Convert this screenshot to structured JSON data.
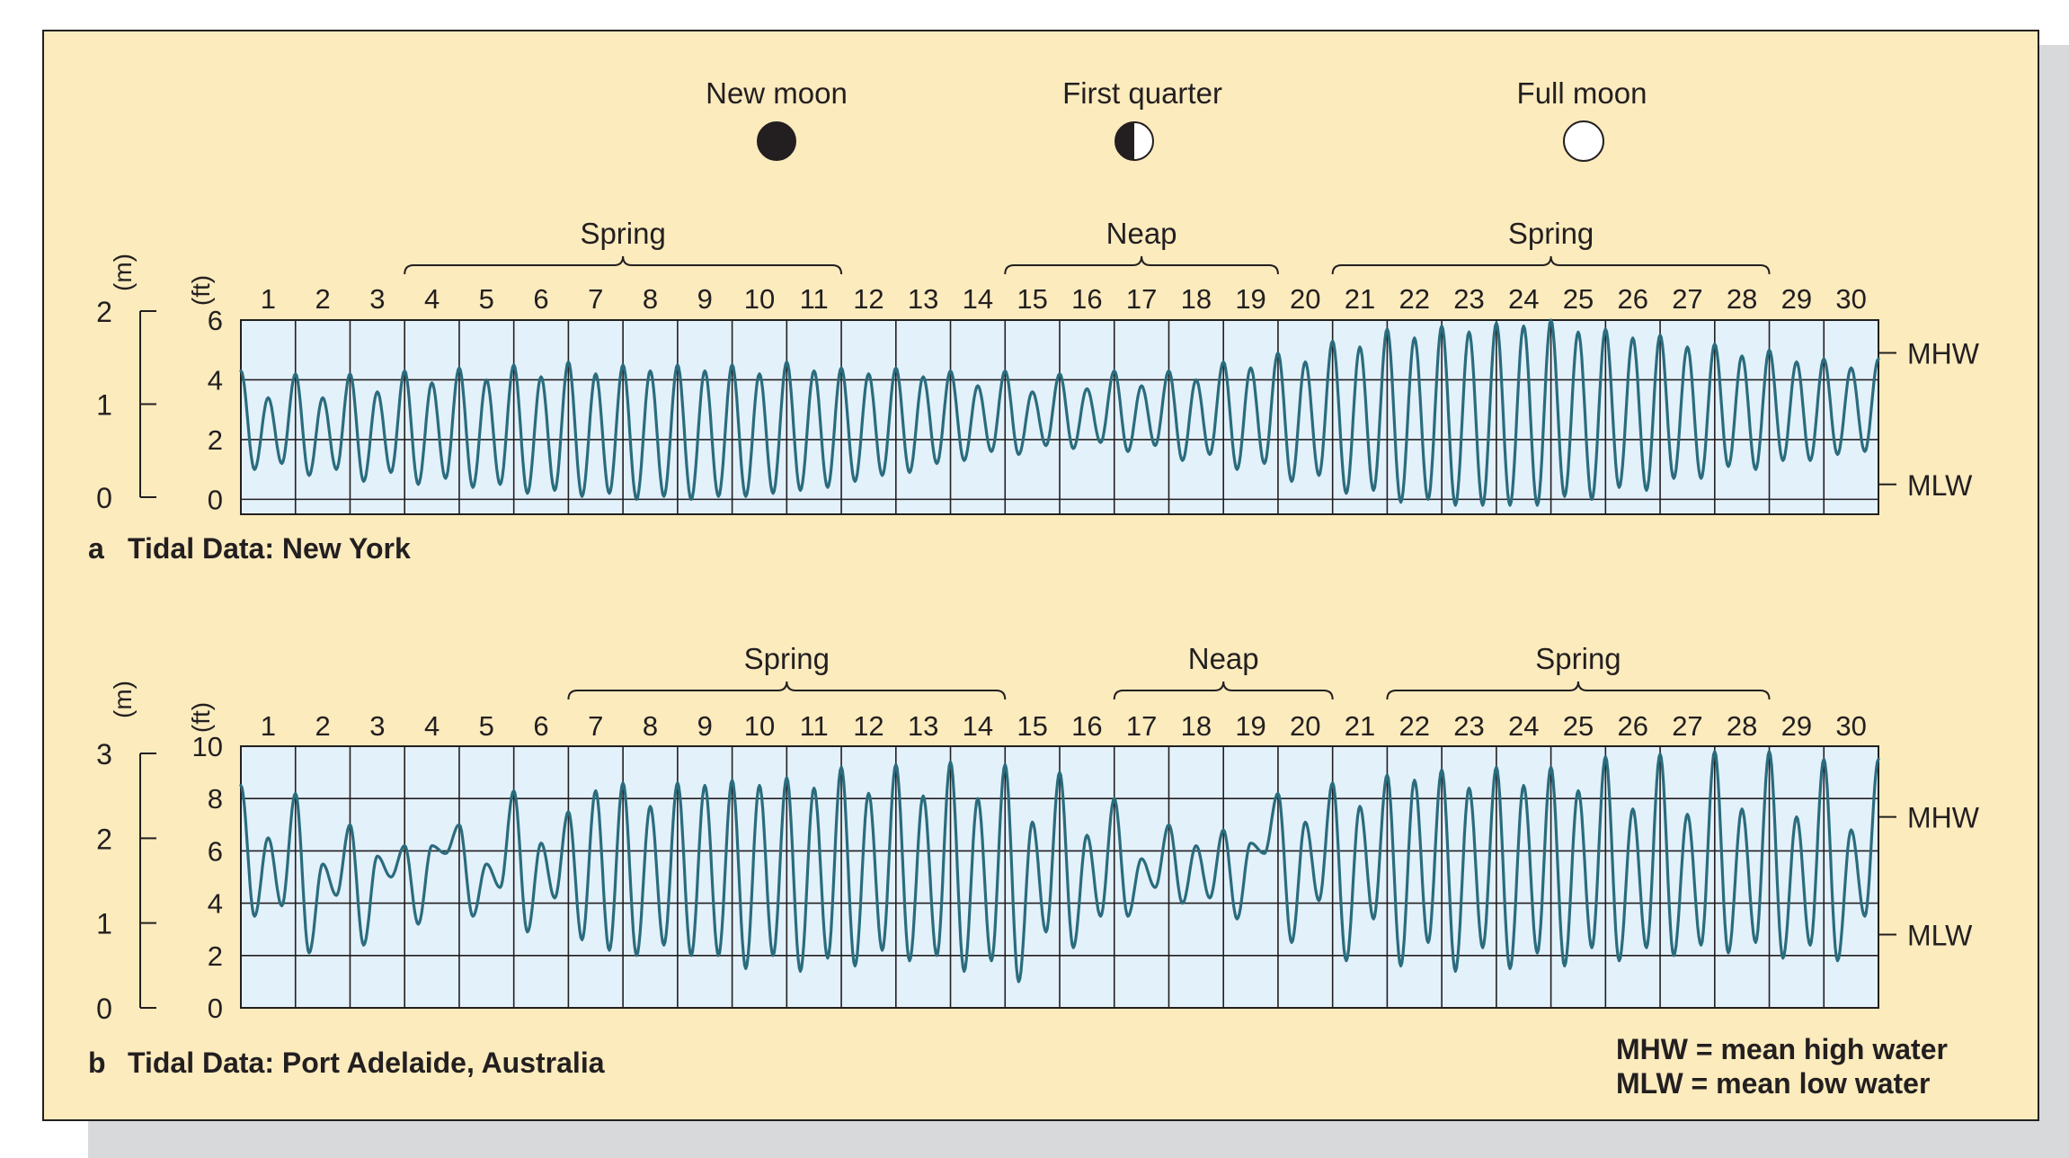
{
  "moon_phases": [
    {
      "label": "New moon",
      "icon": "new-moon-icon",
      "day": 10.3
    },
    {
      "label": "First quarter",
      "icon": "first-quarter-moon-icon",
      "day": 16.9
    },
    {
      "label": "Full moon",
      "icon": "full-moon-icon",
      "day": 24.9
    }
  ],
  "legend": {
    "mhw": "MHW = mean high water",
    "mlw": "MLW = mean low water"
  },
  "colors": {
    "frame_background": "#fbebbd",
    "plot_background": "#e3f1fb",
    "curve": "#2a6c7d",
    "grid": "#231f20"
  },
  "chart_data": [
    {
      "type": "line",
      "panel_letter": "a",
      "title": "Tidal Data: New York",
      "xlabel": "",
      "x_ticks": [
        1,
        2,
        3,
        4,
        5,
        6,
        7,
        8,
        9,
        10,
        11,
        12,
        13,
        14,
        15,
        16,
        17,
        18,
        19,
        20,
        21,
        22,
        23,
        24,
        25,
        26,
        27,
        28,
        29,
        30
      ],
      "x_range": [
        0.5,
        30.5
      ],
      "ylabel_ft": "(ft)",
      "ylabel_m": "(m)",
      "y_ticks_ft": [
        0,
        2,
        4,
        6
      ],
      "ylim_ft": [
        -0.5,
        6
      ],
      "y_ticks_m": [
        0,
        1,
        2
      ],
      "reference_lines": [
        {
          "label": "MHW",
          "value_ft": 4.9
        },
        {
          "label": "MLW",
          "value_ft": 0.5
        }
      ],
      "period_brackets": [
        {
          "label": "Spring",
          "from": 3.5,
          "to": 11.5
        },
        {
          "label": "Neap",
          "from": 14.5,
          "to": 19.5
        },
        {
          "label": "Spring",
          "from": 20.5,
          "to": 28.5
        }
      ],
      "series": [
        {
          "days": [
            1,
            2,
            3,
            4,
            5,
            6,
            7,
            8,
            9,
            10,
            11,
            12,
            13,
            14,
            15,
            16,
            17,
            18,
            19,
            20,
            21,
            22,
            23,
            24,
            25,
            26,
            27,
            28,
            29,
            30
          ],
          "high1_ft": [
            4.3,
            4.2,
            4.2,
            4.3,
            4.4,
            4.5,
            4.6,
            4.5,
            4.5,
            4.5,
            4.6,
            4.4,
            4.4,
            4.3,
            4.3,
            4.2,
            4.3,
            4.3,
            4.6,
            4.9,
            5.3,
            5.7,
            5.8,
            5.9,
            6.0,
            5.7,
            5.5,
            5.2,
            5.0,
            4.7
          ],
          "high2_ft": [
            3.4,
            3.4,
            3.6,
            3.9,
            4.0,
            4.1,
            4.2,
            4.3,
            4.3,
            4.2,
            4.3,
            4.2,
            4.1,
            3.8,
            3.6,
            3.7,
            3.8,
            4.0,
            4.4,
            4.6,
            5.1,
            5.4,
            5.6,
            5.8,
            5.6,
            5.4,
            5.1,
            4.8,
            4.6,
            4.4
          ],
          "low1_ft": [
            1.0,
            0.8,
            0.6,
            0.5,
            0.4,
            0.2,
            0.1,
            0.0,
            0.0,
            0.1,
            0.3,
            0.6,
            0.9,
            1.3,
            1.5,
            1.7,
            1.6,
            1.3,
            1.0,
            0.6,
            0.2,
            -0.1,
            -0.2,
            -0.2,
            0.1,
            0.4,
            0.7,
            1.1,
            1.3,
            1.5
          ],
          "low2_ft": [
            1.2,
            1.0,
            0.9,
            0.7,
            0.5,
            0.3,
            0.2,
            0.1,
            0.1,
            0.2,
            0.4,
            0.8,
            1.2,
            1.6,
            1.8,
            1.9,
            1.8,
            1.5,
            1.2,
            0.8,
            0.3,
            0.0,
            -0.2,
            -0.2,
            0.0,
            0.3,
            0.7,
            1.0,
            1.3,
            1.6
          ]
        }
      ]
    },
    {
      "type": "line",
      "panel_letter": "b",
      "title": "Tidal Data: Port Adelaide, Australia",
      "xlabel": "",
      "x_ticks": [
        1,
        2,
        3,
        4,
        5,
        6,
        7,
        8,
        9,
        10,
        11,
        12,
        13,
        14,
        15,
        16,
        17,
        18,
        19,
        20,
        21,
        22,
        23,
        24,
        25,
        26,
        27,
        28,
        29,
        30
      ],
      "x_range": [
        0.5,
        30.5
      ],
      "ylabel_ft": "(ft)",
      "ylabel_m": "(m)",
      "y_ticks_ft": [
        0,
        2,
        4,
        6,
        8,
        10
      ],
      "ylim_ft": [
        0,
        10
      ],
      "y_ticks_m": [
        0,
        1,
        2,
        3
      ],
      "reference_lines": [
        {
          "label": "MHW",
          "value_ft": 7.3
        },
        {
          "label": "MLW",
          "value_ft": 2.8
        }
      ],
      "period_brackets": [
        {
          "label": "Spring",
          "from": 6.5,
          "to": 14.5
        },
        {
          "label": "Neap",
          "from": 16.5,
          "to": 20.5
        },
        {
          "label": "Spring",
          "from": 21.5,
          "to": 28.5
        }
      ],
      "series": [
        {
          "days": [
            1,
            2,
            3,
            4,
            5,
            6,
            7,
            8,
            9,
            10,
            11,
            12,
            13,
            14,
            15,
            16,
            17,
            18,
            19,
            20,
            21,
            22,
            23,
            24,
            25,
            26,
            27,
            28,
            29,
            30
          ],
          "high1_ft": [
            8.5,
            8.2,
            7.0,
            6.2,
            7.0,
            8.3,
            7.5,
            8.6,
            8.6,
            8.7,
            8.8,
            9.2,
            9.3,
            9.4,
            9.3,
            9.0,
            8.0,
            7.0,
            6.8,
            8.2,
            8.6,
            8.9,
            9.1,
            9.2,
            9.2,
            9.6,
            9.7,
            9.8,
            9.8,
            9.5
          ],
          "high2_ft": [
            6.5,
            5.5,
            5.8,
            6.2,
            5.5,
            6.3,
            8.3,
            7.7,
            8.5,
            8.5,
            8.4,
            8.2,
            8.1,
            8.0,
            7.1,
            6.6,
            5.7,
            6.2,
            6.3,
            7.1,
            7.7,
            8.7,
            8.4,
            8.5,
            8.3,
            7.6,
            7.4,
            7.6,
            7.3,
            6.8
          ],
          "low1_ft": [
            3.5,
            2.1,
            2.4,
            3.2,
            3.5,
            2.9,
            2.6,
            2.0,
            2.0,
            1.5,
            1.4,
            1.6,
            1.8,
            1.4,
            1.0,
            2.3,
            3.5,
            4.0,
            3.4,
            2.5,
            1.8,
            1.6,
            1.4,
            1.5,
            1.6,
            1.8,
            2.0,
            2.1,
            1.9,
            1.8
          ],
          "low2_ft": [
            3.9,
            4.3,
            5.0,
            5.9,
            4.6,
            4.2,
            2.2,
            2.4,
            2.0,
            2.0,
            1.9,
            2.2,
            2.0,
            1.8,
            2.9,
            3.5,
            4.6,
            4.2,
            5.9,
            4.1,
            3.4,
            2.5,
            2.3,
            2.1,
            2.3,
            2.3,
            2.4,
            2.5,
            2.4,
            3.5
          ]
        }
      ]
    }
  ]
}
